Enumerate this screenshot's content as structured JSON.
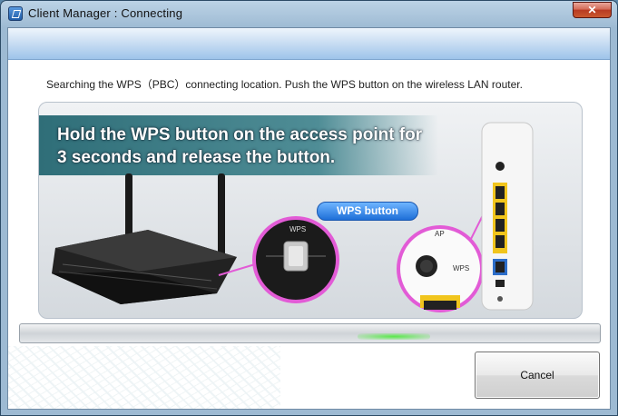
{
  "window": {
    "title": "Client Manager : Connecting",
    "close_glyph": "✕"
  },
  "instruction": "Searching the WPS（PBC）connecting location. Push the WPS button on the wireless LAN router.",
  "illustration": {
    "banner_line1": "Hold the WPS button on the access point for",
    "banner_line2": "3 seconds and release the button.",
    "wps_button_label": "WPS button",
    "router_zoom_label": "WPS",
    "ap_zoom_label_ap": "AP",
    "ap_zoom_label_wps": "WPS"
  },
  "progress": {
    "state": "indeterminate",
    "glow_color": "#59e84a"
  },
  "buttons": {
    "cancel": "Cancel"
  },
  "colors": {
    "accent": "#1e6fd8",
    "banner": "#2f6e78",
    "highlight_ring": "#e25bd6"
  }
}
